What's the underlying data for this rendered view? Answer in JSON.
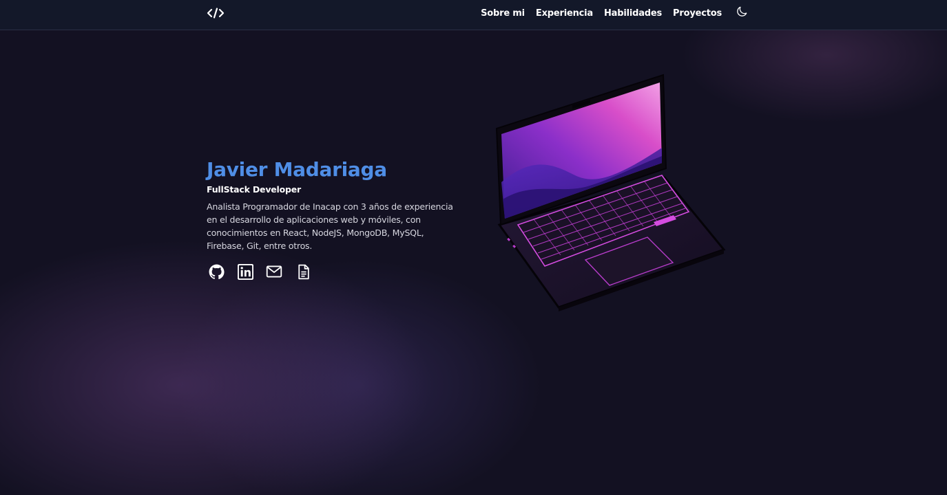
{
  "header": {
    "logo_text": "</>",
    "nav": [
      {
        "label": "Sobre mi"
      },
      {
        "label": "Experiencia"
      },
      {
        "label": "Habilidades"
      },
      {
        "label": "Proyectos"
      }
    ],
    "theme_icon": "moon-icon"
  },
  "hero": {
    "name": "Javier Madariaga",
    "role": "FullStack Developer",
    "bio": "Analista Programador de Inacap con 3 años de experiencia en el desarrollo de aplicaciones web y móviles, con conocimientos en React, NodeJS, MongoDB, MySQL, Firebase, Git, entre otros.",
    "socials": [
      {
        "icon": "github-icon"
      },
      {
        "icon": "linkedin-icon"
      },
      {
        "icon": "mail-icon"
      },
      {
        "icon": "document-icon"
      }
    ],
    "illustration": "laptop-illustration"
  },
  "colors": {
    "accent": "#4f8ee6",
    "background": "#131122",
    "header_bg": "#131829",
    "laptop_glow": "#d44ce0"
  }
}
